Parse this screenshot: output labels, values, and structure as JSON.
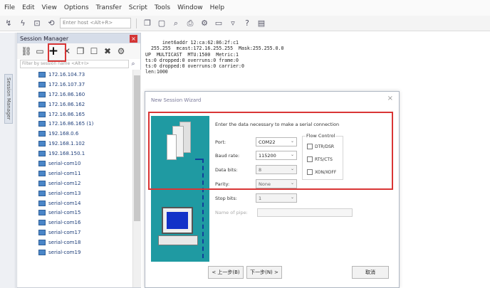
{
  "menu": [
    "File",
    "Edit",
    "View",
    "Options",
    "Transfer",
    "Script",
    "Tools",
    "Window",
    "Help"
  ],
  "toolbar": {
    "host_placeholder": "Enter host <Alt+R>"
  },
  "sidebar_tab": "Session Manager",
  "session_manager": {
    "title": "Session Manager",
    "filter_placeholder": "Filter by session name <Alt+I>",
    "items": [
      "172.16.104.73",
      "172.16.107.37",
      "172.16.86.160",
      "172.16.86.162",
      "172.16.86.165",
      "172.16.86.165 (1)",
      "192.168.0.6",
      "192.168.1.102",
      "192.168.150.1",
      "serial-com10",
      "serial-com11",
      "serial-com12",
      "serial-com13",
      "serial-com14",
      "serial-com15",
      "serial-com16",
      "serial-com17",
      "serial-com18",
      "serial-com19"
    ]
  },
  "terminal": {
    "lines": [
      "      inet6addr 12:ca:62:86:2f:c1",
      "  255.255  mcast:172.16.255.255  Mask:255.255.0.0",
      "UP  MULTICAST  MTU:1500  Metric:1",
      "ts:0 dropped:0 overruns:0 frame:0",
      "ts:0 dropped:0 overruns:0 carrier:0",
      "len:1000"
    ]
  },
  "dialog": {
    "title": "New Session Wizard",
    "description": "Enter the data necessary to make a serial connection",
    "port_label": "Port:",
    "port_value": "COM22",
    "baud_label": "Baud rate:",
    "baud_value": "115200",
    "data_bits_label": "Data bits:",
    "data_bits_value": "8",
    "parity_label": "Parity:",
    "parity_value": "None",
    "stop_bits_label": "Stop bits:",
    "stop_bits_value": "1",
    "name_of_pipe_label": "Name of pipe:",
    "flow_control_title": "Flow Control",
    "flow_control": [
      "DTR/DSR",
      "RTS/CTS",
      "XON/XOFF"
    ],
    "back_button": "< 上一步(B)",
    "next_button": "下一步(N) >",
    "cancel_button": "取消"
  },
  "colors": {
    "highlight_red": "#d93636",
    "wizard_teal": "#1f9aa2",
    "link_blue": "#1f3f7a"
  }
}
